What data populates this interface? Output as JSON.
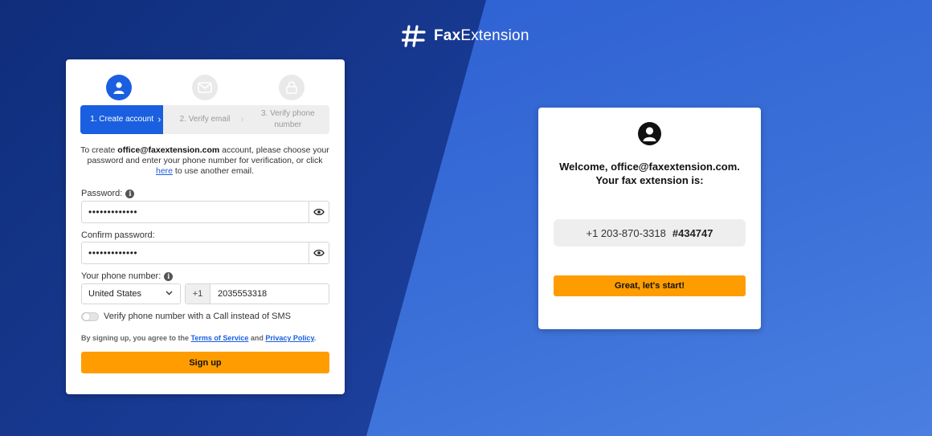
{
  "brand": {
    "name_bold": "Fax",
    "name_rest": "Extension"
  },
  "signup_card": {
    "steps": [
      {
        "label": "1. Create account",
        "active": true
      },
      {
        "label": "2. Verify email",
        "active": false
      },
      {
        "label": "3. Verify phone number",
        "active": false
      }
    ],
    "intro": {
      "prefix": "To create ",
      "email": "office@faxextension.com",
      "middle": " account, please choose your password and enter your phone number for verification, or click ",
      "link": "here",
      "suffix": " to use another email."
    },
    "password": {
      "label": "Password:",
      "value": "•••••••••••••"
    },
    "confirm_password": {
      "label": "Confirm password:",
      "value": "•••••••••••••"
    },
    "phone": {
      "label": "Your phone number:",
      "country": "United States",
      "prefix": "+1",
      "number": "2035553318"
    },
    "toggle_label": "Verify phone number with a Call instead of SMS",
    "terms": {
      "prefix": "By signing up, you agree to the ",
      "tos": "Terms of Service",
      "and": " and ",
      "privacy": "Privacy Policy",
      "suffix": "."
    },
    "submit_label": "Sign up"
  },
  "welcome_card": {
    "line1": "Welcome, office@faxextension.com.",
    "line2": "Your fax extension is:",
    "fax_number": "+1 203-870-3318",
    "extension": "#434747",
    "button_label": "Great, let's start!"
  },
  "colors": {
    "primary": "#1a5fe0",
    "accent": "#ff9d00"
  }
}
